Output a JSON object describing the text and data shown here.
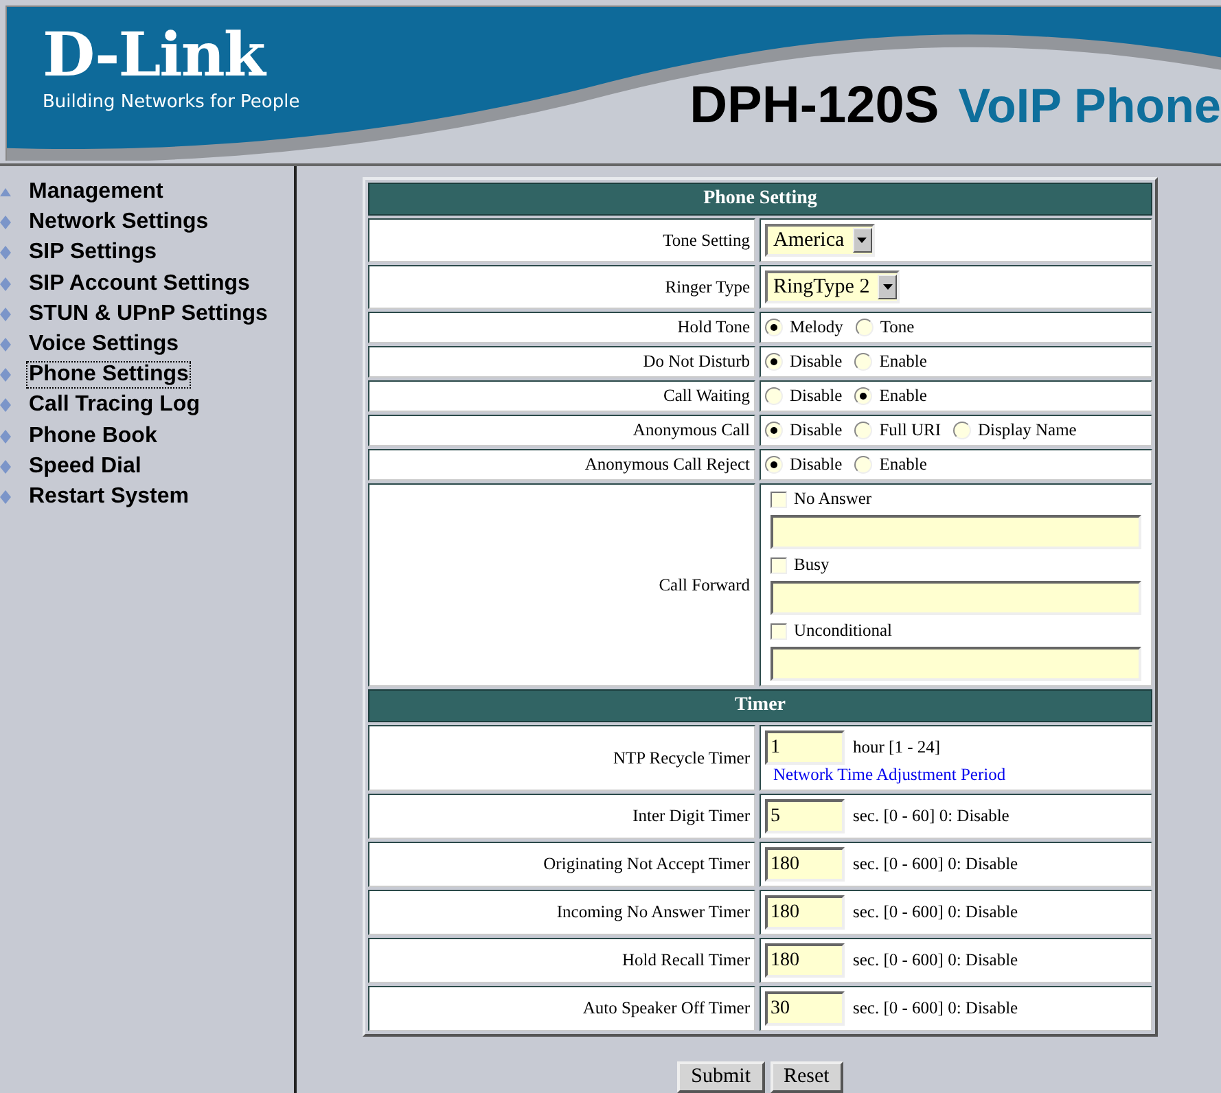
{
  "header": {
    "logo": "D-Link",
    "tagline": "Building Networks for People",
    "model": "DPH-120S",
    "product": "VoIP Phone"
  },
  "sidebar": {
    "items": [
      {
        "label": "Management",
        "kind": "folder",
        "selected": false
      },
      {
        "label": "Network Settings",
        "kind": "page",
        "selected": false
      },
      {
        "label": "SIP Settings",
        "kind": "page",
        "selected": false
      },
      {
        "label": "SIP Account Settings",
        "kind": "page",
        "selected": false
      },
      {
        "label": "STUN & UPnP Settings",
        "kind": "page",
        "selected": false
      },
      {
        "label": "Voice Settings",
        "kind": "page",
        "selected": false
      },
      {
        "label": "Phone Settings",
        "kind": "page",
        "selected": true
      },
      {
        "label": "Call Tracing Log",
        "kind": "page",
        "selected": false
      },
      {
        "label": "Phone Book",
        "kind": "page",
        "selected": false
      },
      {
        "label": "Speed Dial",
        "kind": "page",
        "selected": false
      },
      {
        "label": "Restart System",
        "kind": "page",
        "selected": false
      }
    ]
  },
  "sections": [
    {
      "title": "Phone Setting",
      "rows": [
        {
          "kind": "select",
          "label": "Tone Setting",
          "value": "America"
        },
        {
          "kind": "select",
          "label": "Ringer Type",
          "value": "RingType 2"
        },
        {
          "kind": "radio",
          "label": "Hold Tone",
          "options": [
            {
              "label": "Melody",
              "selected": true
            },
            {
              "label": "Tone",
              "selected": false
            }
          ]
        },
        {
          "kind": "radio",
          "label": "Do Not Disturb",
          "options": [
            {
              "label": "Disable",
              "selected": true
            },
            {
              "label": "Enable",
              "selected": false
            }
          ]
        },
        {
          "kind": "radio",
          "label": "Call Waiting",
          "options": [
            {
              "label": "Disable",
              "selected": false
            },
            {
              "label": "Enable",
              "selected": true
            }
          ]
        },
        {
          "kind": "radio",
          "label": "Anonymous Call",
          "options": [
            {
              "label": "Disable",
              "selected": true
            },
            {
              "label": "Full URI",
              "selected": false
            },
            {
              "label": "Display Name",
              "selected": false
            }
          ]
        },
        {
          "kind": "radio",
          "label": "Anonymous Call Reject",
          "options": [
            {
              "label": "Disable",
              "selected": true
            },
            {
              "label": "Enable",
              "selected": false
            }
          ]
        },
        {
          "kind": "forward",
          "label": "Call Forward",
          "options": [
            {
              "label": "No Answer",
              "checked": false
            },
            {
              "label": "Busy",
              "checked": false
            },
            {
              "label": "Unconditional",
              "checked": false
            }
          ]
        }
      ]
    },
    {
      "title": "Timer",
      "rows": [
        {
          "kind": "timer",
          "label": "NTP Recycle Timer",
          "value": "1",
          "hint": "hour [1 - 24]",
          "link": "Network Time Adjustment Period"
        },
        {
          "kind": "timer",
          "label": "Inter Digit Timer",
          "value": "5",
          "hint": "sec. [0 - 60] 0: Disable"
        },
        {
          "kind": "timer",
          "label": "Originating Not Accept Timer",
          "value": "180",
          "hint": "sec. [0 - 600] 0: Disable"
        },
        {
          "kind": "timer",
          "label": "Incoming No Answer Timer",
          "value": "180",
          "hint": "sec. [0 - 600] 0: Disable"
        },
        {
          "kind": "timer",
          "label": "Hold Recall Timer",
          "value": "180",
          "hint": "sec. [0 - 600] 0: Disable"
        },
        {
          "kind": "timer",
          "label": "Auto Speaker Off Timer",
          "value": "30",
          "hint": "sec. [0 - 600] 0: Disable"
        }
      ]
    }
  ],
  "buttons": [
    "Submit",
    "Reset"
  ]
}
